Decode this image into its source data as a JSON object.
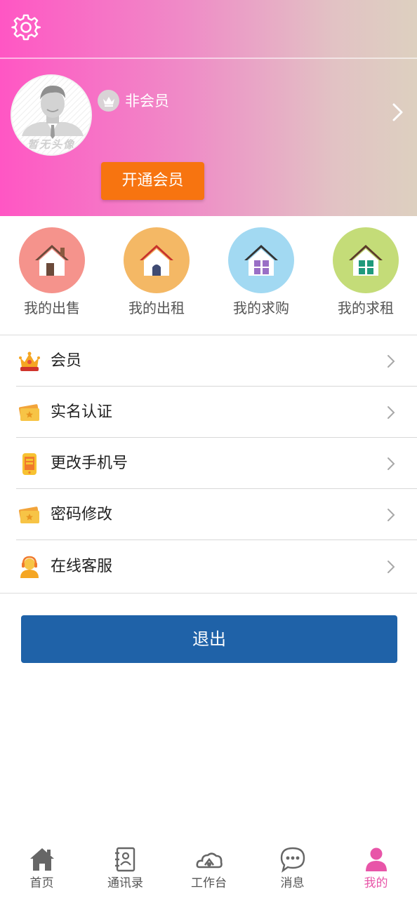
{
  "profile": {
    "avatar_caption": "暂无头像",
    "member_status": "非会员",
    "vip_button_label": "开通会员"
  },
  "shortcuts": [
    {
      "label": "我的出售",
      "color": "#f5938c",
      "icon": "house-door-icon"
    },
    {
      "label": "我的出租",
      "color": "#f4b865",
      "icon": "house-arch-door-icon"
    },
    {
      "label": "我的求购",
      "color": "#a2d9f2",
      "icon": "house-windows-purple-icon"
    },
    {
      "label": "我的求租",
      "color": "#c4dc78",
      "icon": "house-windows-green-icon"
    }
  ],
  "menu": [
    {
      "label": "会员",
      "icon": "crown-icon"
    },
    {
      "label": "实名认证",
      "icon": "ticket-icon"
    },
    {
      "label": "更改手机号",
      "icon": "phone-icon"
    },
    {
      "label": "密码修改",
      "icon": "ticket-icon"
    },
    {
      "label": "在线客服",
      "icon": "customer-service-icon"
    }
  ],
  "logout_label": "退出",
  "tabs": [
    {
      "label": "首页",
      "icon": "home-icon"
    },
    {
      "label": "通讯录",
      "icon": "contacts-icon"
    },
    {
      "label": "工作台",
      "icon": "workbench-icon"
    },
    {
      "label": "消息",
      "icon": "message-icon"
    },
    {
      "label": "我的",
      "icon": "user-icon",
      "active": true
    }
  ],
  "colors": {
    "accent_pink": "#e855a8",
    "vip_orange": "#f77410",
    "logout_blue": "#1f62a8"
  }
}
